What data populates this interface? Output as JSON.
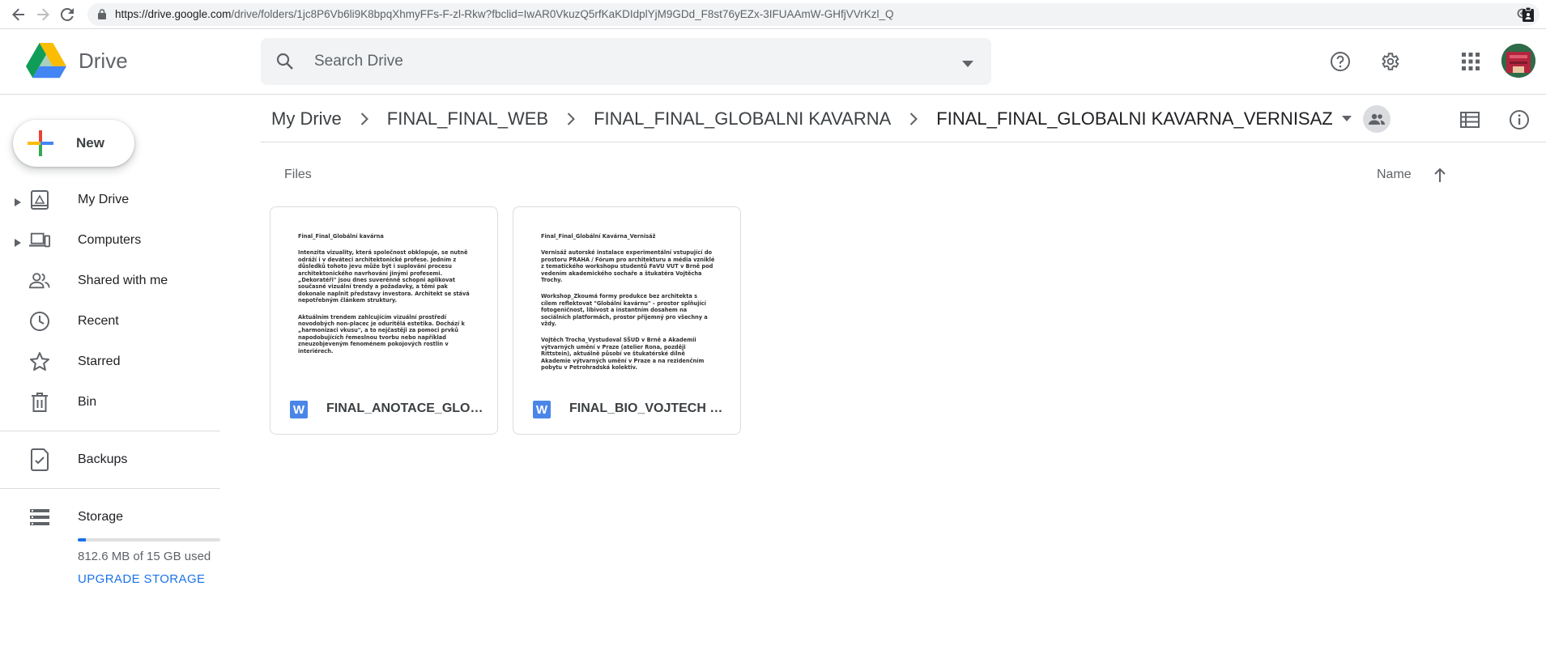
{
  "browser": {
    "url_host": "https://drive.google.com",
    "url_path": "/drive/folders/1jc8P6Vb6li9K8bpqXhmyFFs-F-zl-Rkw?fbclid=IwAR0VkuzQ5rfKaKDIdplYjM9GDd_F8st76yEZx-3IFUAAmW-GHfjVVrKzl_Q"
  },
  "header": {
    "product_name": "Drive",
    "search_placeholder": "Search Drive",
    "icons": [
      "help-icon",
      "settings-icon",
      "apps-icon",
      "avatar"
    ]
  },
  "sidebar": {
    "new_label": "New",
    "items": [
      {
        "label": "My Drive",
        "icon": "my-drive-icon",
        "expandable": true
      },
      {
        "label": "Computers",
        "icon": "computers-icon",
        "expandable": true
      },
      {
        "label": "Shared with me",
        "icon": "shared-icon",
        "expandable": false
      },
      {
        "label": "Recent",
        "icon": "clock-icon",
        "expandable": false
      },
      {
        "label": "Starred",
        "icon": "star-icon",
        "expandable": false
      },
      {
        "label": "Bin",
        "icon": "trash-icon",
        "expandable": false
      }
    ],
    "backups_label": "Backups",
    "storage": {
      "label": "Storage",
      "used_text": "812.6 MB of 15 GB used",
      "used_fraction": 0.054,
      "upgrade_label": "UPGRADE STORAGE"
    }
  },
  "breadcrumb": {
    "items": [
      "My Drive",
      "FINAL_FINAL_WEB",
      "FINAL_FINAL_GLOBALNI KAVARNA",
      "FINAL_FINAL_GLOBALNI KAVARNA_VERNISAZ"
    ]
  },
  "content": {
    "section_label": "Files",
    "sort_label": "Name",
    "files": [
      {
        "name": "FINAL_ANOTACE_GLOB...",
        "type_icon": "W",
        "preview": {
          "title": "Final_Final_Globální kavárna",
          "paragraphs": [
            "Intenzita vizuality, která společnost obklopuje, se nutně odráží i v deváteci architektonické profese. Jedním z důsledků tohoto jevu může být i suplování procesu architektonického navrhování jinými profesemi. „Dekoratéři\" jsou dnes suverénně schopni aplikovat současné vizuální trendy a požadavky, a těmi pak dokonale naplnit představy investora. Architekt se stává nepotřebným článkem struktury.",
            "Aktuálním trendem zahlcujícím vizuální prostředí novodobých non-placec je oduritělá estetika. Dochází k „harmonizaci vkusu\", a to nejčastěji za pomoci prvků napodobujících řemeslnou tvorbu nebo například zneuzobjeveným fenoménem pokojových rostlin v interiérech."
          ]
        }
      },
      {
        "name": "FINAL_BIO_VOJTECH TR...",
        "type_icon": "W",
        "preview": {
          "title": "Final_Final_Globální Kavárna_Vernisáž",
          "paragraphs": [
            "Vernisáž autorské instalace experimentální vstupující do prostoru PRAHA / Fórum pro architekturu a média vzniklé z tematického workshopu studentů FaVU VUT v Brně pod vedením akademického sochaře a štukatéra Vojtěcha Trochy.",
            "Workshop_Zkoumá formy produkce bez architekta s cílem reflektovat \"Globální kavárnu\" – prostor splňující fotogeničnost, libivost a instantním dosahem na sociálních platformách, prostor příjemný pro všechny a vždy.",
            "Vojtěch Trocha_Vystudoval SŠUD v Brně a Akademii výtvarných umění v Praze (atelier Rona, později Rittstein), aktuálně působí ve štukatérské dílně Akademie výtvarných umění v Praze a na rezidenčním pobytu v Petrohradská kolektiv."
          ]
        }
      }
    ]
  }
}
